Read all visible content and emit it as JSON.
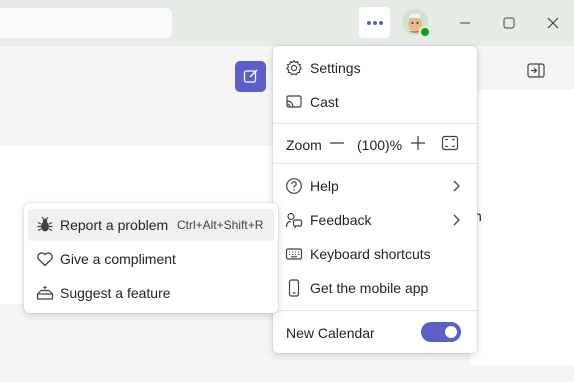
{
  "menu": {
    "settings": "Settings",
    "cast": "Cast",
    "zoom_label": "Zoom",
    "zoom_value": "(100)%",
    "help": "Help",
    "feedback": "Feedback",
    "keyboard_shortcuts": "Keyboard shortcuts",
    "get_mobile_app": "Get the mobile app",
    "new_calendar": "New Calendar",
    "new_calendar_enabled": true
  },
  "feedback_submenu": {
    "report_problem": "Report a problem",
    "report_shortcut": "Ctrl+Alt+Shift+R",
    "give_compliment": "Give a compliment",
    "suggest_feature": "Suggest a feature"
  },
  "background": {
    "stray_text": "n"
  },
  "colors": {
    "accent": "#5b5fc7",
    "presence_available": "#13a10e",
    "titlebar": "#e6ebe6"
  },
  "icons": {
    "more": "more-horizontal-icon",
    "avatar": "user-avatar",
    "minimize": "minimize-icon",
    "maximize": "maximize-icon",
    "close": "close-icon",
    "compose": "compose-icon",
    "side_panel": "side-panel-icon",
    "settings": "gear-icon",
    "cast": "cast-icon",
    "zoom_out": "minus-icon",
    "zoom_in": "plus-icon",
    "fit": "fit-screen-icon",
    "help": "question-circle-icon",
    "feedback": "feedback-icon",
    "keyboard": "keyboard-icon",
    "mobile": "phone-icon",
    "bug": "bug-icon",
    "heart": "heart-icon",
    "feature": "sparkle-box-icon"
  }
}
